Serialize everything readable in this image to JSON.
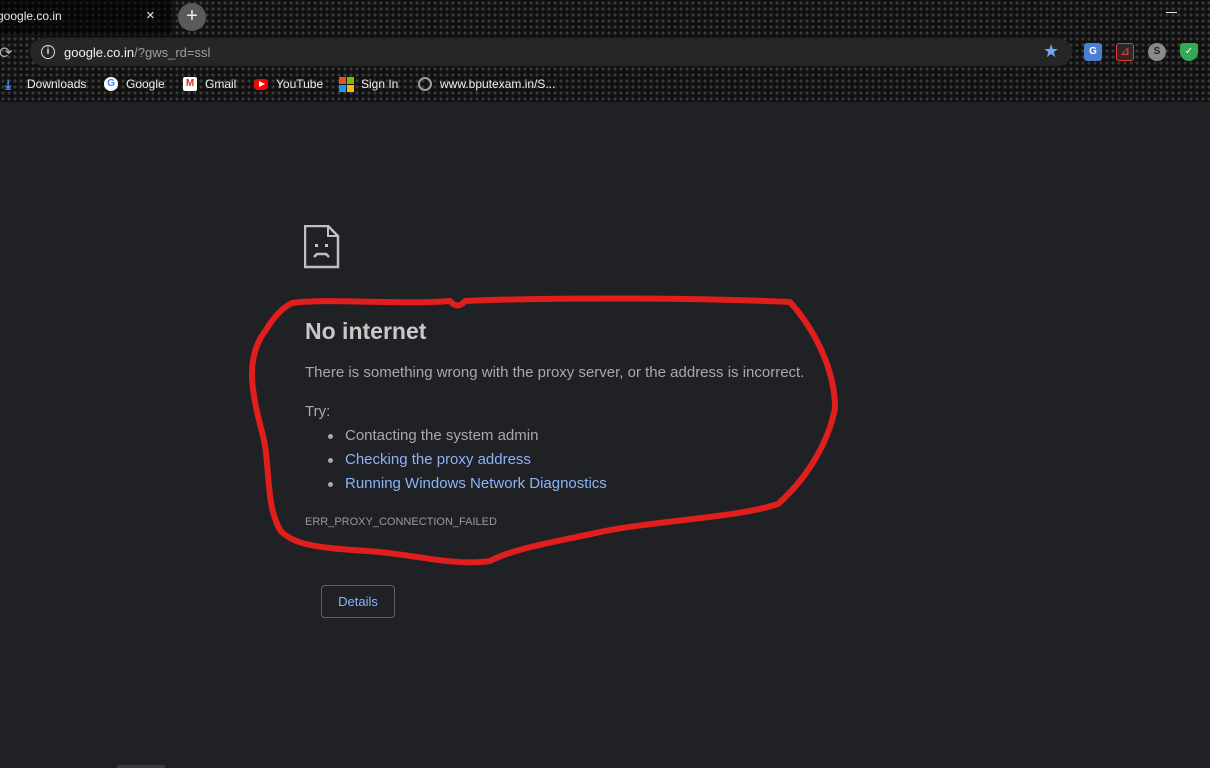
{
  "tab": {
    "title": "google.co.in",
    "close_icon": "×",
    "new_tab_icon": "+"
  },
  "address_bar": {
    "info_icon": "i",
    "host": "google.co.in",
    "path": "/?gws_rd=ssl"
  },
  "extensions": [
    "translate-icon",
    "pdf-icon",
    "skype-icon",
    "shield-icon"
  ],
  "bookmarks": [
    {
      "label": "Downloads",
      "icon": "download-icon"
    },
    {
      "label": "Google",
      "icon": "google-icon"
    },
    {
      "label": "Gmail",
      "icon": "gmail-icon"
    },
    {
      "label": "YouTube",
      "icon": "youtube-icon"
    },
    {
      "label": "Sign In",
      "icon": "microsoft-icon"
    },
    {
      "label": "www.bputexam.in/S...",
      "icon": "globe-icon"
    }
  ],
  "error": {
    "title": "No internet",
    "description": "There is something wrong with the proxy server, or the address is incorrect.",
    "try_label": "Try:",
    "suggestions": [
      "Contacting the system admin",
      "Checking the proxy address",
      "Running Windows Network Diagnostics"
    ],
    "code": "ERR_PROXY_CONNECTION_FAILED",
    "details_button": "Details"
  },
  "colors": {
    "page_background": "#202124",
    "link": "#8ab4f8",
    "annotation_stroke": "#e01e1e",
    "bookmark_star": "#6ea8ff"
  }
}
